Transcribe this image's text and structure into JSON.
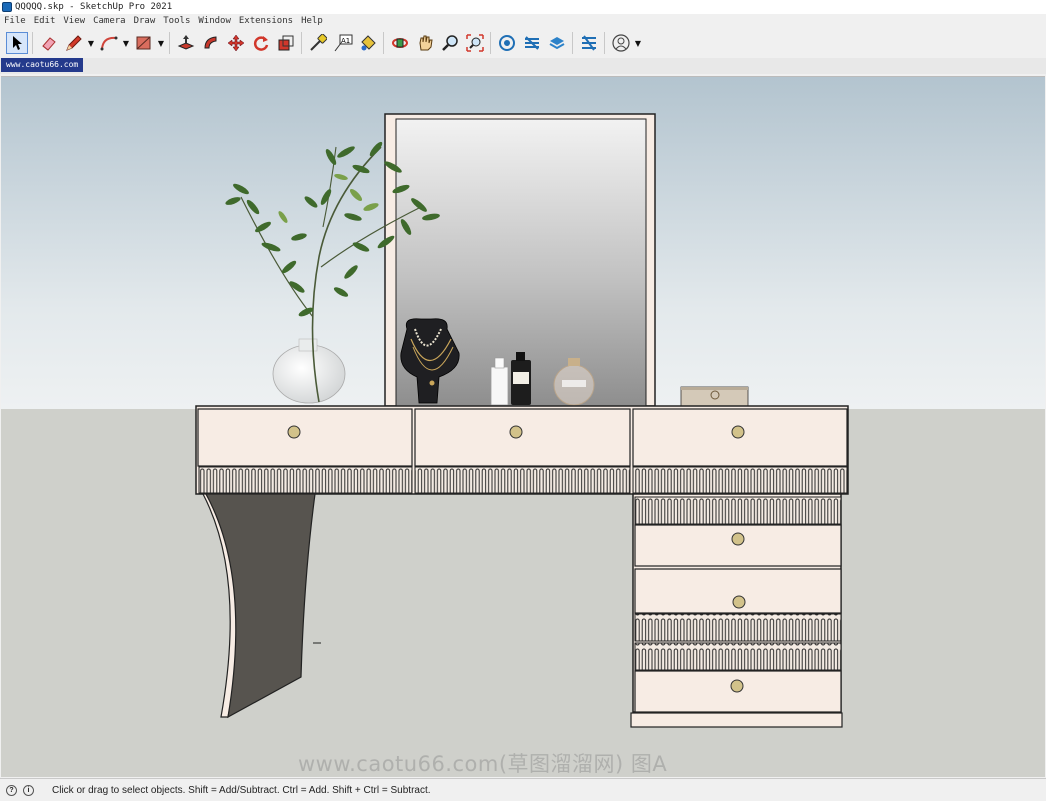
{
  "window": {
    "title": "QQQQQ.skp - SketchUp Pro 2021"
  },
  "menu": [
    "File",
    "Edit",
    "View",
    "Camera",
    "Draw",
    "Tools",
    "Window",
    "Extensions",
    "Help"
  ],
  "toolbar": {
    "tools": [
      {
        "name": "select-icon",
        "active": true
      },
      {
        "name": "eraser-icon"
      },
      {
        "name": "pencil-line-icon"
      },
      {
        "name": "arc-icon"
      },
      {
        "name": "rectangle-icon"
      },
      {
        "name": "push-pull-icon"
      },
      {
        "name": "follow-me-icon"
      },
      {
        "name": "move-icon"
      },
      {
        "name": "rotate-icon"
      },
      {
        "name": "scale-icon"
      },
      {
        "name": "tape-measure-icon"
      },
      {
        "name": "text-icon"
      },
      {
        "name": "paint-bucket-icon"
      },
      {
        "name": "orbit-icon"
      },
      {
        "name": "pan-icon"
      },
      {
        "name": "zoom-icon"
      },
      {
        "name": "zoom-extents-icon"
      },
      {
        "name": "3d-warehouse-icon"
      },
      {
        "name": "extension-warehouse-icon"
      },
      {
        "name": "layout-icon"
      },
      {
        "name": "extension-manager-icon"
      },
      {
        "name": "account-icon"
      }
    ],
    "text_tool_label": "A1"
  },
  "scene_tab": {
    "label": "www.caotu66.com"
  },
  "viewport": {
    "watermark": "www.caotu66.com(草图溜溜网) 图A",
    "colors": {
      "sky_top": "#b3c4cf",
      "sky_bottom": "#eef1f2",
      "ground": "#cfd0cb",
      "desk": "#f7ece4",
      "leg": "#57544f",
      "knob": "#d2c28a"
    }
  },
  "status": {
    "message": "Click or drag to select objects. Shift = Add/Subtract. Ctrl = Add. Shift + Ctrl = Subtract."
  }
}
